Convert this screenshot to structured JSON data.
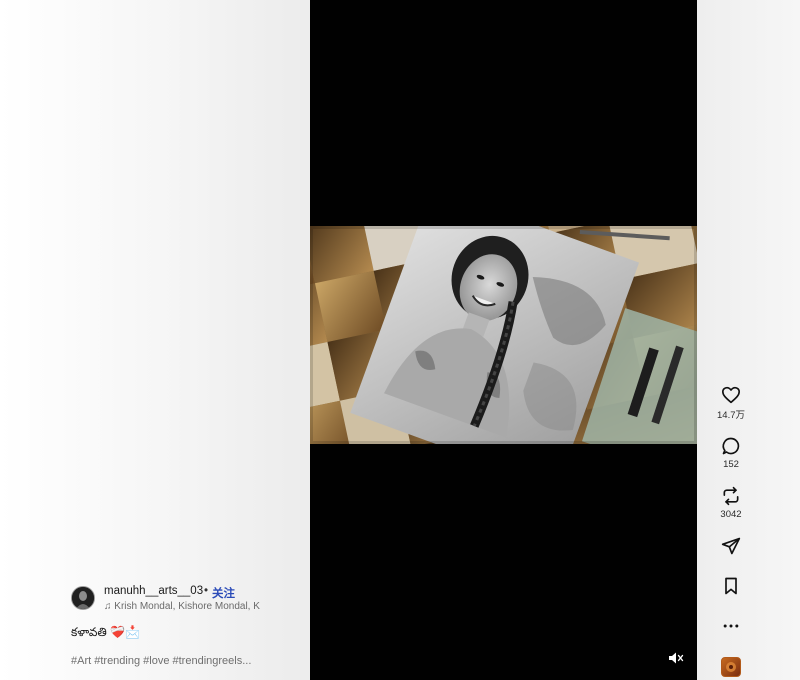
{
  "author": {
    "username": "manuhh__arts__03",
    "separator": "•",
    "follow_label": "关注",
    "music_note_icon": "music-note-icon",
    "music_text": "Krish Mondal, Kishore Mondal, K"
  },
  "caption": {
    "text": "కళావతి ❤️‍🩹📩"
  },
  "hashtags": "#Art #trending #love #trendingreels...",
  "actions": {
    "likes": "14.7万",
    "comments": "152",
    "reposts": "3042"
  },
  "colors": {
    "follow": "#2b4bb8",
    "video_bg": "#010101"
  }
}
